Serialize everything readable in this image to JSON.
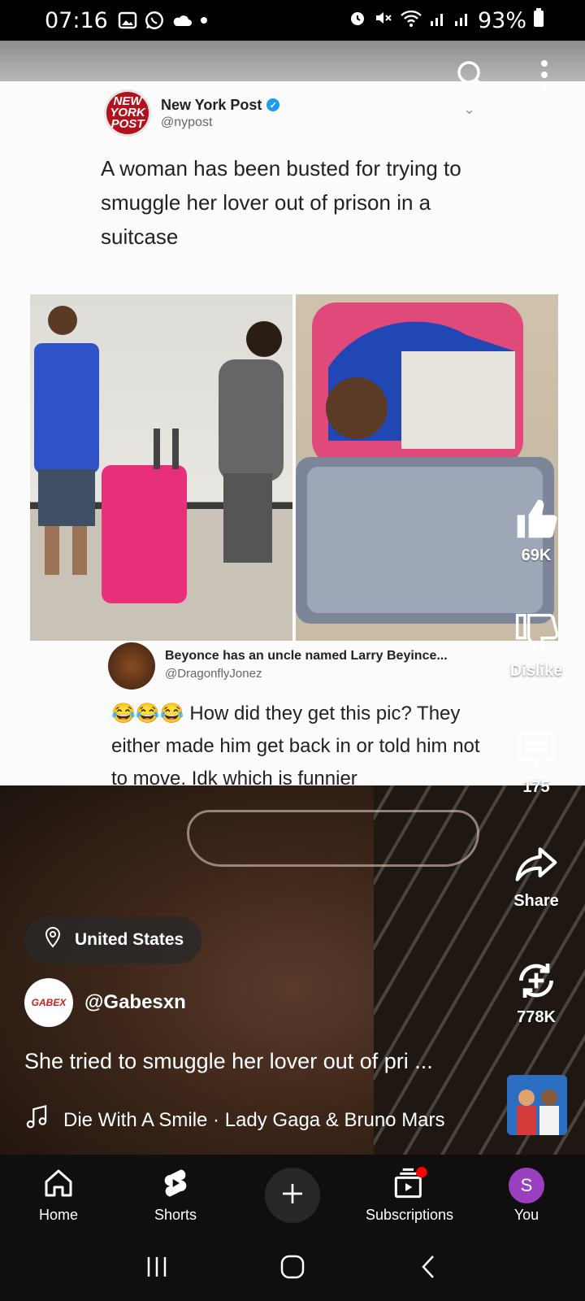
{
  "status_bar": {
    "time": "07:16",
    "battery": "93%",
    "icons": [
      "gallery-icon",
      "whatsapp-icon",
      "cloud-icon",
      "dot-icon",
      "alarm-icon",
      "mute-icon",
      "wifi-icon",
      "signal-icon",
      "signal-icon",
      "battery-icon"
    ]
  },
  "top_actions": {
    "icons": [
      "search-icon",
      "more-vert-icon"
    ]
  },
  "tweet": {
    "author": "New York Post",
    "handle": "@nypost",
    "logo_text": "NEW YORK POST",
    "text": "A woman has been busted for trying to smuggle her lover out of prison in a suitcase"
  },
  "reply": {
    "author": "Beyonce has an uncle named Larry Beyince...",
    "handle": "@DragonflyJonez",
    "emojis": "😂😂😂",
    "text": "How did they get this pic? They either made him get back in or told him not to move. Idk which is funnier"
  },
  "actions": {
    "like_count": "69K",
    "dislike_label": "Dislike",
    "comment_count": "175",
    "share_label": "Share",
    "remix_count": "778K"
  },
  "location": "United States",
  "channel": {
    "name": "@Gabesxn",
    "avatar_text": "GABEX"
  },
  "video_title": "She tried to smuggle her lover out of pri ...",
  "music": "Die With A Smile · Lady Gaga & Bruno Mars",
  "nav": {
    "home": "Home",
    "shorts": "Shorts",
    "subscriptions": "Subscriptions",
    "you": "You",
    "you_initial": "S"
  },
  "colors": {
    "background": "#0f0f0f",
    "avatar": "#9b3fc1",
    "notification": "#ff0000",
    "nypost_red": "#b3121d"
  }
}
